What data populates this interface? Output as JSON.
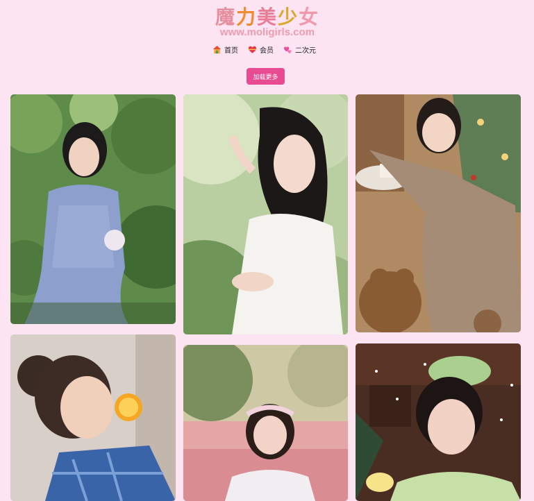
{
  "site": {
    "logo_chars": [
      "魔",
      "力",
      "美",
      "少",
      "女"
    ],
    "logo_colors": [
      "#e78f9e",
      "#f08a2e",
      "#ea7c96",
      "#d8a92a",
      "#ef9aac"
    ],
    "logo_url": "www.moligirls.com"
  },
  "nav": {
    "items": [
      {
        "label": "首页",
        "icon": "home-icon"
      },
      {
        "label": "会员",
        "icon": "heart-icon"
      },
      {
        "label": "二次元",
        "icon": "two-hearts-icon"
      }
    ]
  },
  "actions": {
    "load_more_label": "加载更多"
  },
  "colors": {
    "page_bg": "#fde4f2",
    "accent": "#e94b93"
  },
  "gallery": {
    "items": [
      {
        "alt": "photo-girl-blue-dress-garden"
      },
      {
        "alt": "photo-girl-white-dress"
      },
      {
        "alt": "photo-girl-christmas-teddy-bear"
      },
      {
        "alt": "photo-girl-orange-blue-plaid"
      },
      {
        "alt": "photo-girl-pink-field-headband"
      },
      {
        "alt": "photo-girl-green-bow-piano"
      }
    ]
  }
}
